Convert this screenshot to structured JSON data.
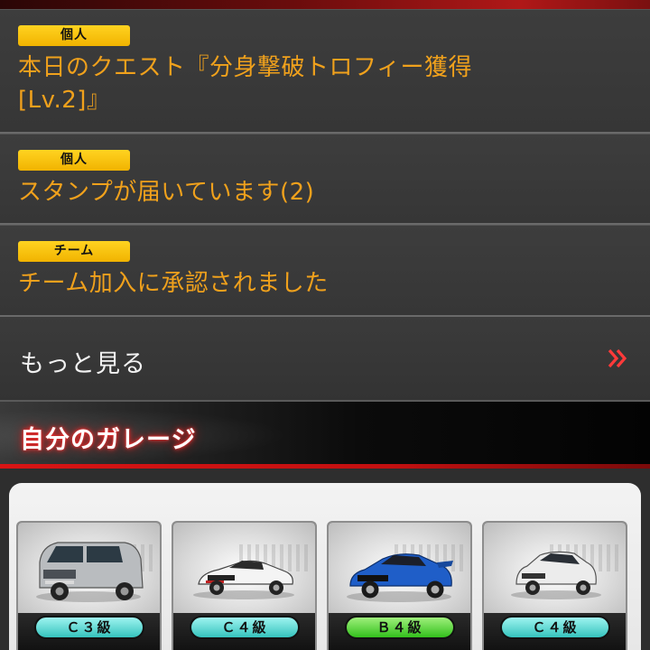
{
  "notices": [
    {
      "tag": "個人",
      "text_line1": "本日のクエスト『分身撃破トロフィー獲得",
      "text_line2": "[Lv.2]』"
    },
    {
      "tag": "個人",
      "text_line1": "スタンプが届いています(2)",
      "text_line2": ""
    },
    {
      "tag": "チーム",
      "text_line1": "チーム加入に承認されました",
      "text_line2": ""
    }
  ],
  "more": {
    "label": "もっと見る",
    "icon": "double-chevron-right-icon"
  },
  "garage": {
    "title": "自分のガレージ",
    "cars": [
      {
        "grade": "Ｃ３級",
        "color": "#b9bcbf",
        "grade_color": "cyan",
        "kind": "van"
      },
      {
        "grade": "Ｃ４級",
        "color": "#f2f2f2",
        "grade_color": "cyan",
        "kind": "sports"
      },
      {
        "grade": "Ｂ４級",
        "color": "#1f5ec8",
        "grade_color": "green",
        "kind": "coupe"
      },
      {
        "grade": "Ｃ４級",
        "color": "#e8e8e8",
        "grade_color": "cyan",
        "kind": "hatch"
      }
    ]
  },
  "colors": {
    "accent_orange": "#f0a11c",
    "tag_yellow": "#ffd321",
    "header_red": "#d81414"
  }
}
